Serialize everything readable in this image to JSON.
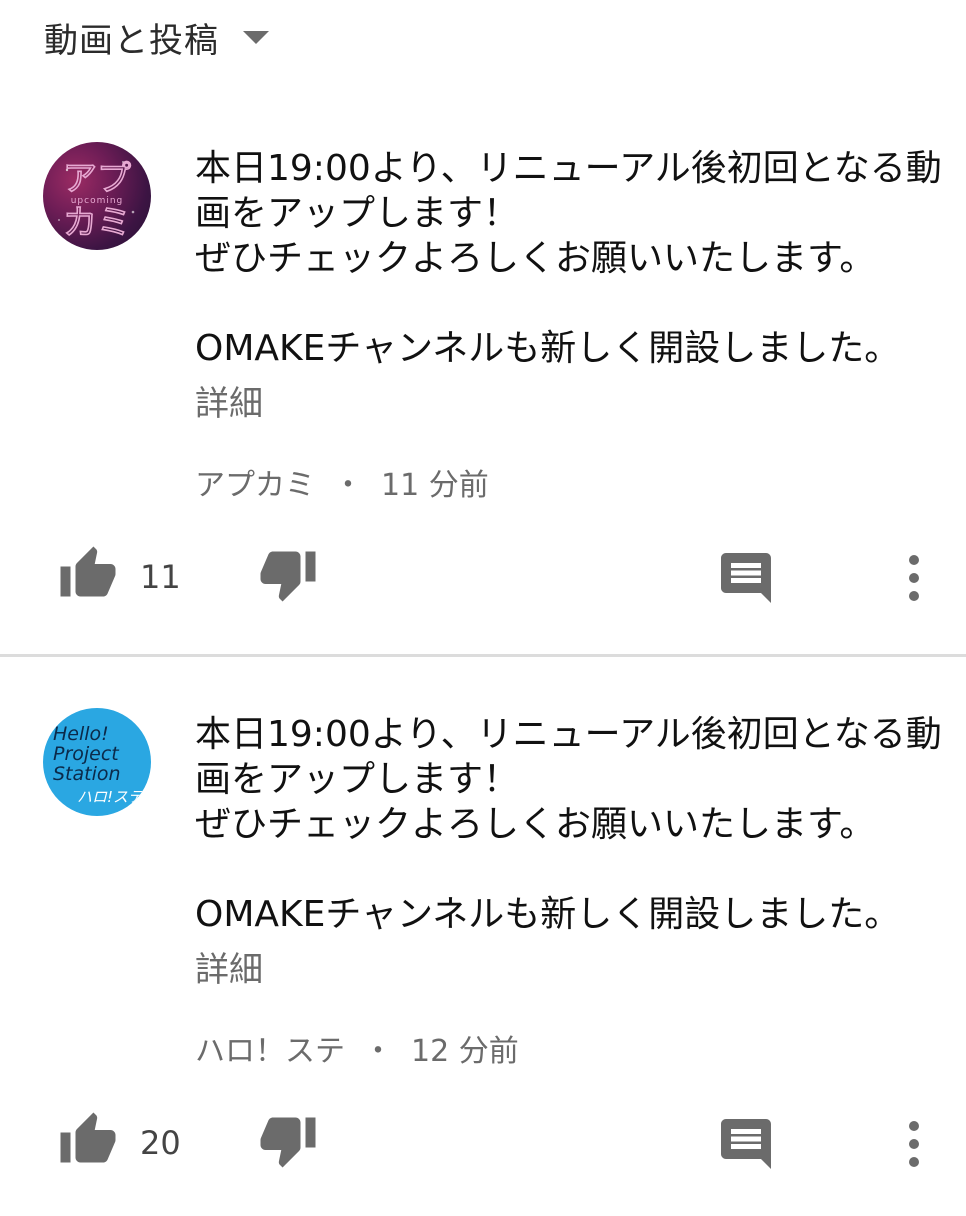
{
  "filter": {
    "label": "動画と投稿"
  },
  "colors": {
    "icon_gray": "#6b6b6b",
    "secondary_text": "#6b6b6b",
    "divider": "#dcdcdc",
    "avatar_blue": "#2aa7e2",
    "avatar_purple": "#6e1d56"
  },
  "posts": [
    {
      "avatar_text": {
        "line1": "アプ",
        "line2": "カミ",
        "small": "upcoming"
      },
      "body": "本日19:00より、リニューアル後初回となる動画をアップします！\nぜひチェックよろしくお願いいたします。\n\nOMAKEチャンネルも新しく開設しました。",
      "more_label": "詳細",
      "author": "アプカミ",
      "separator": "・",
      "time": "11 分前",
      "like_count": "11",
      "icons": [
        "thumb-up-icon",
        "thumb-down-icon",
        "comment-icon",
        "more-vert-icon"
      ]
    },
    {
      "avatar_text": {
        "line1": "Hello!",
        "line2": "Project",
        "line3": "Station",
        "small": "ハロ!ステ"
      },
      "body": "本日19:00より、リニューアル後初回となる動画をアップします！\nぜひチェックよろしくお願いいたします。\n\nOMAKEチャンネルも新しく開設しました。",
      "more_label": "詳細",
      "author": "ハロ！ステ",
      "separator": "・",
      "time": "12 分前",
      "like_count": "20",
      "icons": [
        "thumb-up-icon",
        "thumb-down-icon",
        "comment-icon",
        "more-vert-icon"
      ]
    }
  ]
}
